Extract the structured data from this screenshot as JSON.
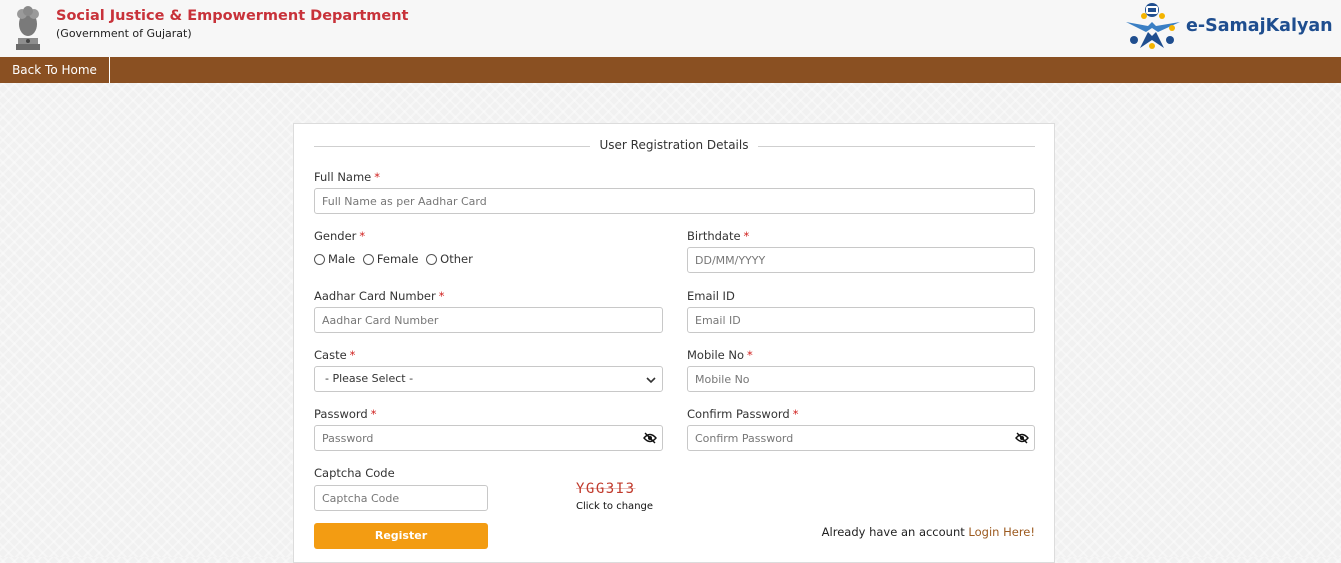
{
  "header": {
    "department": "Social Justice & Empowerment Department",
    "government": "(Government of Gujarat)",
    "brand": "e-SamajKalyan",
    "emblem_icon": "national-emblem-icon",
    "brand_icon": "e-samajkalyan-logo-icon"
  },
  "nav": {
    "back_home": "Back To Home"
  },
  "form": {
    "title": "User Registration Details",
    "full_name": {
      "label": "Full Name",
      "placeholder": "Full Name as per Aadhar Card",
      "required": "*"
    },
    "gender": {
      "label": "Gender",
      "required": "*",
      "options": [
        "Male",
        "Female",
        "Other"
      ]
    },
    "birthdate": {
      "label": "Birthdate",
      "placeholder": "DD/MM/YYYY",
      "required": "*"
    },
    "aadhar": {
      "label": "Aadhar Card Number",
      "placeholder": "Aadhar Card Number",
      "required": "*"
    },
    "email": {
      "label": "Email ID",
      "placeholder": "Email ID"
    },
    "caste": {
      "label": "Caste",
      "value": "- Please Select -",
      "required": "*"
    },
    "mobile": {
      "label": "Mobile No",
      "placeholder": "Mobile No",
      "required": "*"
    },
    "password": {
      "label": "Password",
      "placeholder": "Password",
      "required": "*"
    },
    "confirm_password": {
      "label": "Confirm Password",
      "placeholder": "Confirm Password",
      "required": "*"
    },
    "captcha": {
      "label": "Captcha Code",
      "placeholder": "Captcha Code",
      "image_text": "YGG3I3",
      "change_text": "Click to change"
    },
    "register": "Register",
    "login_prompt": "Already have an account",
    "login_link": "Login Here!"
  },
  "colors": {
    "nav_bg": "#8a5022",
    "accent": "#f39c12",
    "title_red": "#c8323a",
    "brand_blue": "#1f4e8f",
    "required": "#d0201e"
  }
}
